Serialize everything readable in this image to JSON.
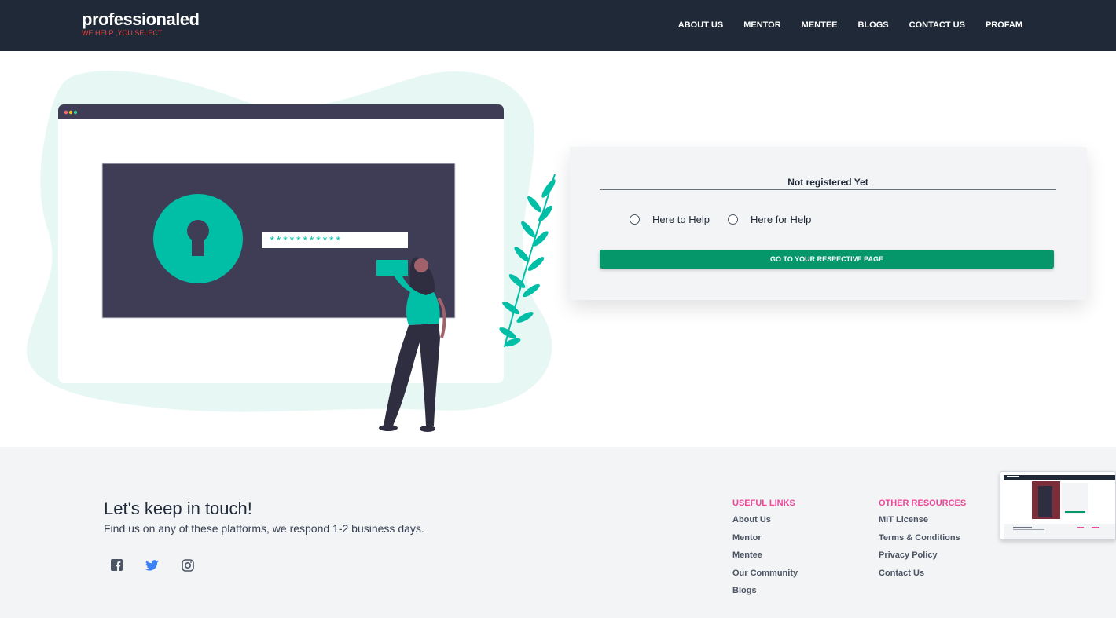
{
  "header": {
    "brand_name": "professionaled",
    "brand_tagline": "WE HELP ,YOU SELECT",
    "nav": [
      "ABOUT US",
      "MENTOR",
      "MENTEE",
      "BLOGS",
      "CONTACT US",
      "PROFAM"
    ]
  },
  "illustration": {
    "password_mask": "***********"
  },
  "card": {
    "title": "Not registered Yet",
    "radio_options": [
      "Here to Help",
      "Here for Help"
    ],
    "button_label": "GO TO YOUR RESPECTIVE PAGE"
  },
  "footer": {
    "title": "Let's keep in touch!",
    "subtitle": "Find us on any of these platforms, we respond 1-2 business days.",
    "social_icons": [
      "facebook-icon",
      "twitter-icon",
      "instagram-icon"
    ],
    "useful_links_title": "USEFUL LINKS",
    "useful_links": [
      "About Us",
      "Mentor",
      "Mentee",
      "Our Community",
      "Blogs"
    ],
    "other_resources_title": "OTHER RESOURCES",
    "other_resources": [
      "MIT License",
      "Terms & Conditions",
      "Privacy Policy",
      "Contact Us"
    ]
  },
  "colors": {
    "navbar": "#1f2937",
    "tagline": "#ef4444",
    "accent_teal": "#00bfa6",
    "button": "#059669",
    "footer_heading": "#ec4899"
  }
}
